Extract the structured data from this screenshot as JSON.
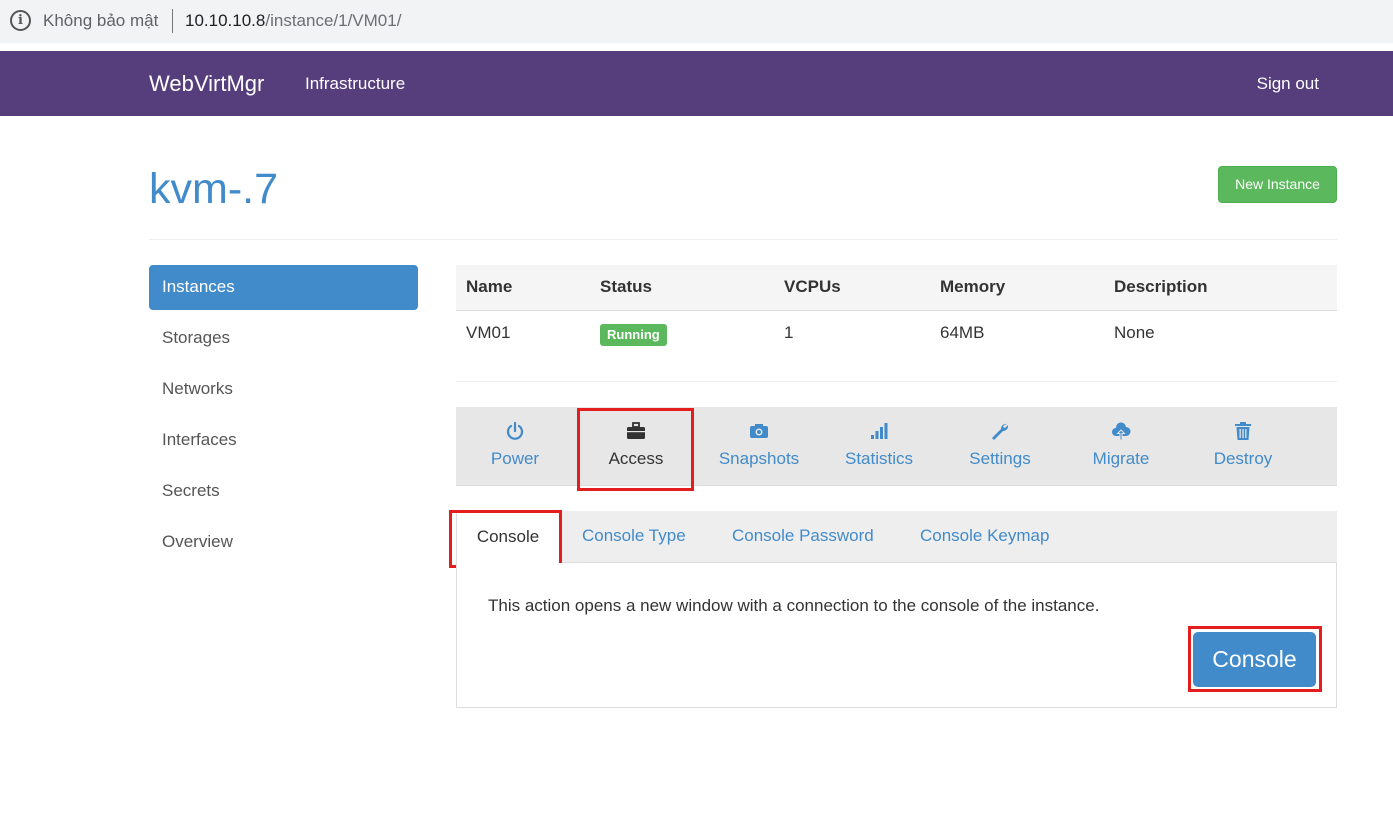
{
  "browser": {
    "security_label": "Không bảo mật",
    "url_host": "10.10.10.8",
    "url_path": "/instance/1/VM01/"
  },
  "navbar": {
    "brand": "WebVirtMgr",
    "infrastructure": "Infrastructure",
    "sign_out": "Sign out",
    "color": "#563d7c"
  },
  "page": {
    "title": "kvm-.7",
    "new_instance": "New Instance"
  },
  "sidebar": {
    "items": [
      {
        "label": "Instances",
        "active": true
      },
      {
        "label": "Storages"
      },
      {
        "label": "Networks"
      },
      {
        "label": "Interfaces"
      },
      {
        "label": "Secrets"
      },
      {
        "label": "Overview"
      }
    ]
  },
  "table": {
    "headers": [
      "Name",
      "Status",
      "VCPUs",
      "Memory",
      "Description"
    ],
    "row": {
      "name": "VM01",
      "status": "Running",
      "vcpus": "1",
      "memory": "64MB",
      "description": "None"
    }
  },
  "actions": [
    {
      "label": "Power",
      "icon": "power-icon"
    },
    {
      "label": "Access",
      "icon": "briefcase-icon",
      "active": true
    },
    {
      "label": "Snapshots",
      "icon": "camera-icon"
    },
    {
      "label": "Statistics",
      "icon": "signal-icon"
    },
    {
      "label": "Settings",
      "icon": "wrench-icon"
    },
    {
      "label": "Migrate",
      "icon": "cloud-upload-icon"
    },
    {
      "label": "Destroy",
      "icon": "trash-icon"
    }
  ],
  "subtabs": [
    {
      "label": "Console",
      "active": true
    },
    {
      "label": "Console Type"
    },
    {
      "label": "Console Password"
    },
    {
      "label": "Console Keymap"
    }
  ],
  "console_panel": {
    "message": "This action opens a new window with a connection to the console of the instance.",
    "button": "Console"
  },
  "colors": {
    "primary": "#428bca",
    "success": "#5cb85c",
    "highlight": "#e41e1e"
  }
}
